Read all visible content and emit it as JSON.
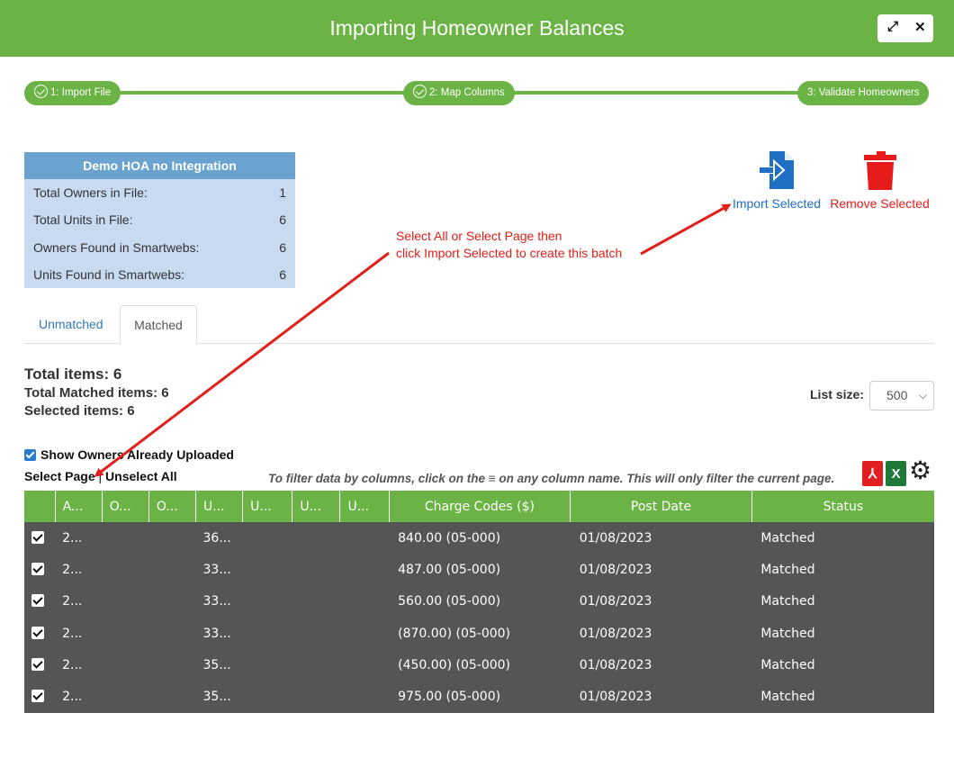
{
  "window": {
    "title": "Importing Homeowner Balances",
    "expand_glyph": "⤢",
    "close_glyph": "✕"
  },
  "steps": [
    {
      "label": "1: Import File",
      "done": true
    },
    {
      "label": "2: Map Columns",
      "done": true
    },
    {
      "label": "3: Validate Homeowners",
      "done": false
    }
  ],
  "summary": {
    "title": "Demo HOA no Integration",
    "rows": [
      {
        "label": "Total Owners in File:",
        "value": "1"
      },
      {
        "label": "Total Units in File:",
        "value": "6"
      },
      {
        "label": "Owners Found in Smartwebs:",
        "value": "6"
      },
      {
        "label": "Units Found in Smartwebs:",
        "value": "6"
      }
    ]
  },
  "actions": {
    "import_label": "Import Selected",
    "remove_label": "Remove Selected",
    "import_color": "#1f6fc5",
    "remove_color": "#e81b1b"
  },
  "annotation": {
    "line1": "Select All or Select Page then",
    "line2": "click Import Selected to create this batch",
    "color": "#e0201b"
  },
  "tabs": [
    {
      "label": "Unmatched"
    },
    {
      "label": "Matched"
    }
  ],
  "totals": {
    "total_items": "Total items: 6",
    "total_matched": "Total Matched items: 6",
    "selected": "Selected items: 6"
  },
  "list_size": {
    "label": "List size:",
    "value": "500"
  },
  "show_owners_label": "Show Owners Already Uploaded",
  "select_page_label": "Select Page",
  "separator": "|",
  "unselect_all_label": "Unselect All",
  "filter_hint": "To filter data by columns, click on the ≡ on any column name. This will only filter the current page.",
  "table": {
    "columns": [
      "A...",
      "O...",
      "O...",
      "U...",
      "U...",
      "U...",
      "U...",
      "Charge Codes ($)",
      "Post Date",
      "Status"
    ],
    "rows": [
      [
        "2...",
        "",
        "",
        "36...",
        "",
        "",
        "",
        "840.00 (05-000)",
        "01/08/2023",
        "Matched"
      ],
      [
        "2...",
        "",
        "",
        "33...",
        "",
        "",
        "",
        "487.00 (05-000)",
        "01/08/2023",
        "Matched"
      ],
      [
        "2...",
        "",
        "",
        "33...",
        "",
        "",
        "",
        "560.00 (05-000)",
        "01/08/2023",
        "Matched"
      ],
      [
        "2...",
        "",
        "",
        "33...",
        "",
        "",
        "",
        "(870.00) (05-000)",
        "01/08/2023",
        "Matched"
      ],
      [
        "2...",
        "",
        "",
        "35...",
        "",
        "",
        "",
        "(450.00) (05-000)",
        "01/08/2023",
        "Matched"
      ],
      [
        "2...",
        "",
        "",
        "35...",
        "",
        "",
        "",
        "975.00 (05-000)",
        "01/08/2023",
        "Matched"
      ]
    ]
  },
  "colors": {
    "accent": "#6ab344",
    "row_bg": "#555555",
    "summary_header": "#6aa3cf",
    "summary_body": "#c7daf0"
  }
}
